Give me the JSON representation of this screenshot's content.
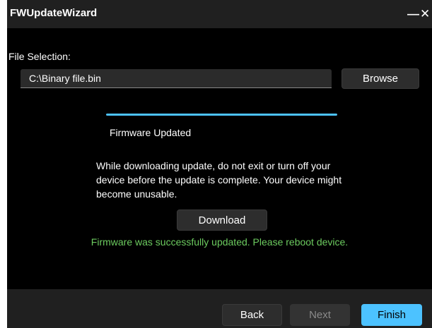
{
  "window": {
    "title": "FWUpdateWizard",
    "minimize_glyph": "—",
    "close_glyph": "✕"
  },
  "file_selection": {
    "label": "File Selection:",
    "value": "C:\\Binary file.bin",
    "browse_label": "Browse"
  },
  "progress": {
    "value_percent": 100,
    "label": "Firmware Updated",
    "color": "#4cc2ff"
  },
  "warning_text": "While downloading update, do not exit or turn off your device before the update is complete. Your device might become unusable.",
  "download_label": "Download",
  "status": {
    "text": "Firmware was successfully updated. Please reboot device.",
    "color": "#6ccb5f"
  },
  "footer": {
    "back_label": "Back",
    "next_label": "Next",
    "finish_label": "Finish"
  },
  "colors": {
    "accent": "#4cc2ff",
    "success": "#6ccb5f"
  }
}
